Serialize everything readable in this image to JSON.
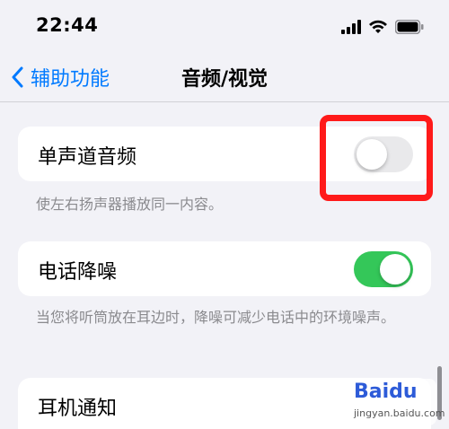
{
  "status_bar": {
    "time": "22:44"
  },
  "nav": {
    "back_label": "辅助功能",
    "title": "音频/视觉"
  },
  "settings": [
    {
      "label": "单声道音频",
      "toggle": "off",
      "footer": "使左右扬声器播放同一内容。"
    },
    {
      "label": "电话降噪",
      "toggle": "on",
      "footer": "当您将听筒放在耳边时，降噪可减少电话中的环境噪声。"
    },
    {
      "label": "耳机通知"
    }
  ],
  "watermark": {
    "logo": "Baidu",
    "sub": "jingyan.baidu.com"
  },
  "colors": {
    "accent": "#007aff",
    "toggle_on": "#34c759",
    "highlight": "#ff1a1a"
  }
}
